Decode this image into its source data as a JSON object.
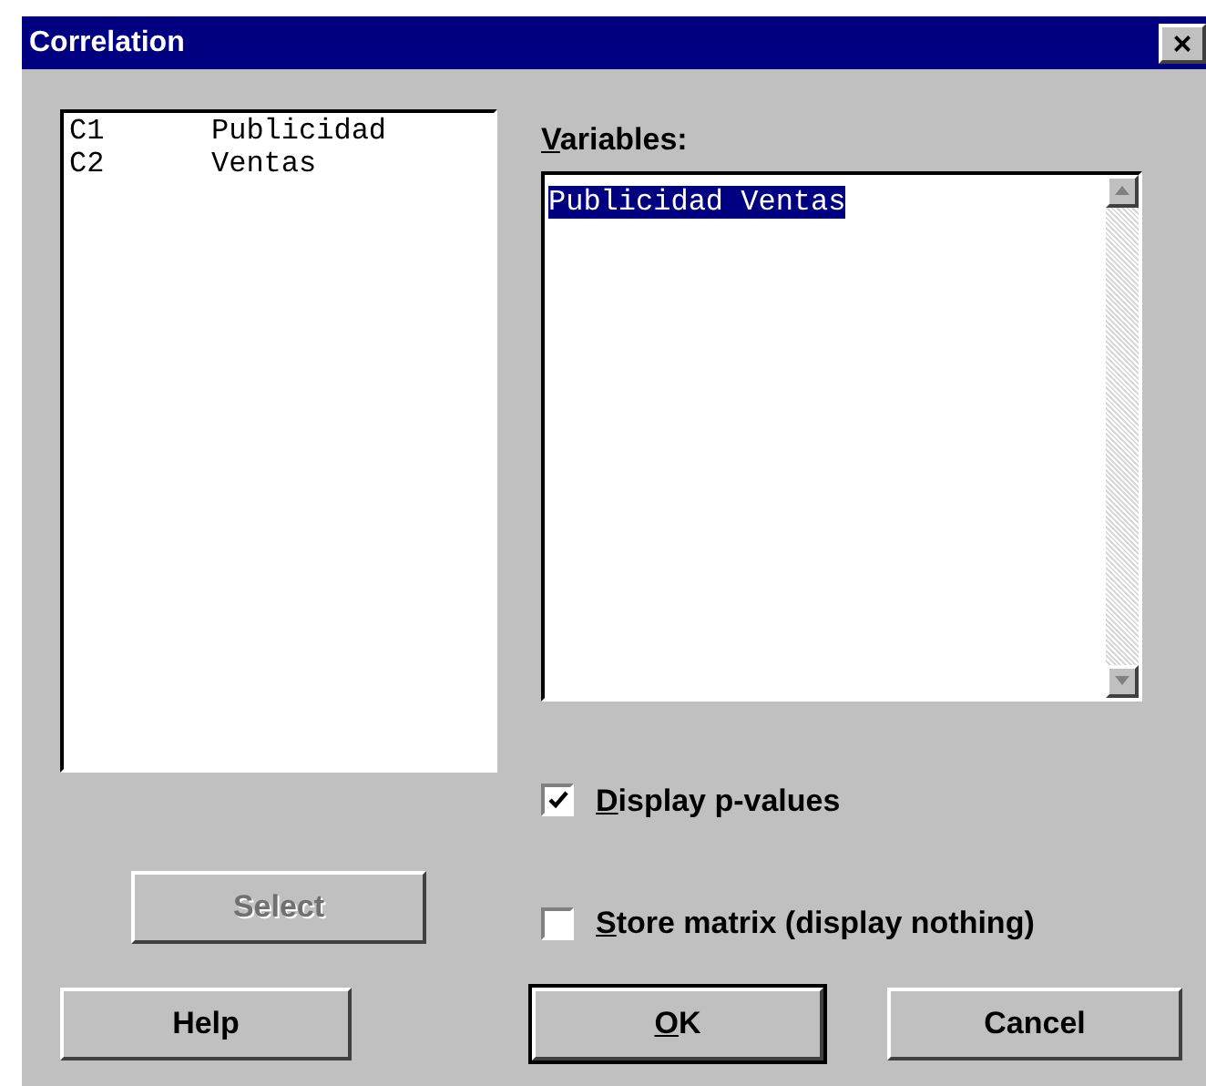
{
  "window": {
    "title": "Correlation",
    "close": "×"
  },
  "columns_list": [
    {
      "id": "C1",
      "name": "Publicidad"
    },
    {
      "id": "C2",
      "name": "Ventas"
    }
  ],
  "variables": {
    "label": "Variables:",
    "value": "Publicidad Ventas"
  },
  "options": [
    {
      "label": "Display p-values",
      "checked": true
    },
    {
      "label": "Store matrix (display nothing)",
      "checked": false
    }
  ],
  "select_button": {
    "label": "Select",
    "disabled": true
  },
  "buttons": [
    {
      "label": "Help",
      "default": false
    },
    {
      "label": "OK",
      "default": true
    },
    {
      "label": "Cancel",
      "default": false
    }
  ]
}
